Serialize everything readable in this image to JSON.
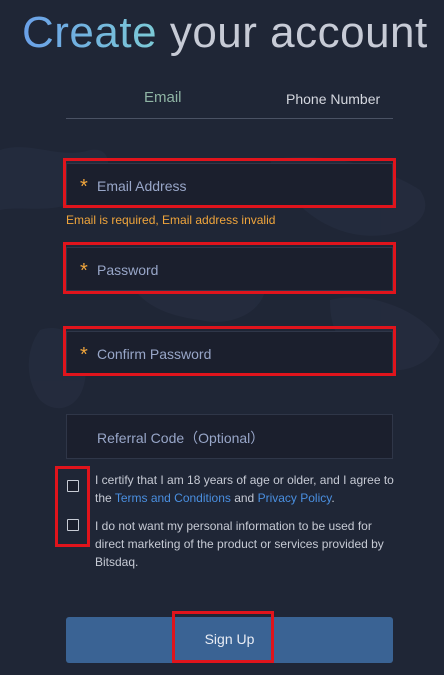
{
  "header": {
    "title_part1": "Create",
    "title_part2": "your account"
  },
  "tabs": [
    {
      "label": "Email",
      "active": true
    },
    {
      "label": "Phone Number",
      "active": false
    }
  ],
  "form": {
    "email": {
      "placeholder": "Email Address",
      "required": true,
      "value": ""
    },
    "email_error": "Email is required, Email address invalid",
    "password": {
      "placeholder": "Password",
      "required": true,
      "value": ""
    },
    "confirm_password": {
      "placeholder": "Confirm Password",
      "required": true,
      "value": ""
    },
    "referral": {
      "placeholder": "Referral Code（Optional）",
      "required": false,
      "value": ""
    },
    "required_marker": "*"
  },
  "consents": {
    "agree_text_1": "I certify that I am 18 years of age or older, and I agree to the ",
    "terms_link": "Terms and Conditions",
    "agree_and": " and ",
    "privacy_link": "Privacy Policy",
    "agree_end": ".",
    "agree_checked": false,
    "optout_text": "I do not want my personal information to be used for direct marketing of the product or services provided by Bitsdaq.",
    "optout_checked": false
  },
  "submit": {
    "label": "Sign Up"
  },
  "colors": {
    "background": "#1f2636",
    "accent_required": "#f0a53c",
    "link": "#4a8fe0",
    "button": "#3a6394",
    "highlight_box": "#e0141c"
  }
}
